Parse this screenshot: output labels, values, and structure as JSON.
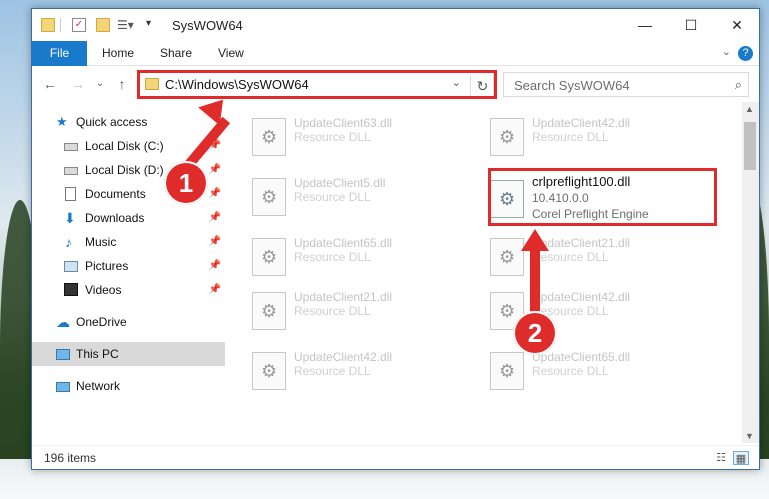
{
  "window": {
    "title": "SysWOW64"
  },
  "ribbon": {
    "tabs": [
      "File",
      "Home",
      "Share",
      "View"
    ],
    "help_label": "?"
  },
  "nav": {
    "address": "C:\\Windows\\SysWOW64",
    "search_placeholder": "Search SysWOW64"
  },
  "sidebar": {
    "items": [
      {
        "label": "Quick access",
        "icon": "star-icon",
        "pinned": false
      },
      {
        "label": "Local Disk (C:)",
        "icon": "drive-icon",
        "pinned": true
      },
      {
        "label": "Local Disk (D:)",
        "icon": "drive-icon",
        "pinned": true
      },
      {
        "label": "Documents",
        "icon": "documents-icon",
        "pinned": true
      },
      {
        "label": "Downloads",
        "icon": "download-icon",
        "pinned": true
      },
      {
        "label": "Music",
        "icon": "music-icon",
        "pinned": true
      },
      {
        "label": "Pictures",
        "icon": "pictures-icon",
        "pinned": true
      },
      {
        "label": "Videos",
        "icon": "videos-icon",
        "pinned": true
      },
      {
        "label": "OneDrive",
        "icon": "cloud-icon",
        "pinned": false
      },
      {
        "label": "This PC",
        "icon": "computer-icon",
        "pinned": false,
        "selected": true
      },
      {
        "label": "Network",
        "icon": "network-icon",
        "pinned": false
      }
    ]
  },
  "files": {
    "left": [
      {
        "name": "UpdateClient63.dll",
        "type": "Resource DLL"
      },
      {
        "name": "UpdateClient5.dll",
        "type": "Resource DLL"
      },
      {
        "name": "UpdateClient65.dll",
        "type": "Resource DLL"
      },
      {
        "name": "UpdateClient21.dll",
        "type": "Resource DLL"
      },
      {
        "name": "UpdateClient42.dll",
        "type": "Resource DLL"
      }
    ],
    "right": [
      {
        "name": "UpdateClient42.dll",
        "type": "Resource DLL"
      },
      {
        "name": "UpdateClient21.dll",
        "type": "Resource DLL"
      },
      {
        "name": "UpdateClient42.dll",
        "type": "Resource DLL"
      },
      {
        "name": "UpdateClient65.dll",
        "type": "Resource DLL"
      }
    ],
    "highlighted": {
      "name": "crlpreflight100.dll",
      "version": "10.410.0.0",
      "description": "Corel Preflight Engine"
    }
  },
  "status": {
    "item_count": "196 items"
  },
  "annotations": {
    "marker1": "1",
    "marker2": "2",
    "accent": "#e02b2b"
  }
}
